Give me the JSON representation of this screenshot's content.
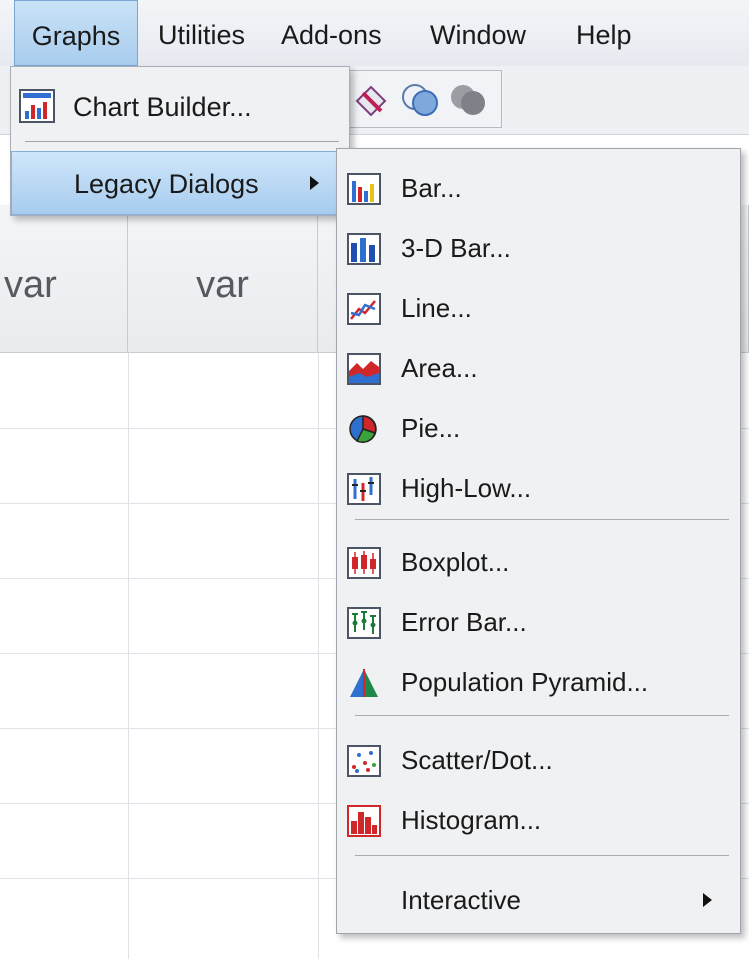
{
  "menubar": {
    "items": [
      {
        "label": "Graphs",
        "active": true
      },
      {
        "label": "Utilities"
      },
      {
        "label": "Add-ons"
      },
      {
        "label": "Window"
      },
      {
        "label": "Help"
      }
    ]
  },
  "grid": {
    "col_headers": [
      "var",
      "var"
    ]
  },
  "graphs_menu": {
    "items": [
      {
        "label": "Chart Builder...",
        "icon": "chart-builder-icon"
      },
      {
        "label": "Legacy Dialogs",
        "icon": "none",
        "has_submenu": true,
        "highlighted": true
      }
    ]
  },
  "legacy_menu": {
    "items": [
      {
        "label": "Bar...",
        "icon": "bar-chart-icon"
      },
      {
        "label": "3-D Bar...",
        "icon": "3d-bar-chart-icon"
      },
      {
        "label": "Line...",
        "icon": "line-chart-icon"
      },
      {
        "label": "Area...",
        "icon": "area-chart-icon"
      },
      {
        "label": "Pie...",
        "icon": "pie-chart-icon"
      },
      {
        "label": "High-Low...",
        "icon": "high-low-chart-icon"
      },
      {
        "label": "Boxplot...",
        "icon": "boxplot-icon"
      },
      {
        "label": "Error Bar...",
        "icon": "error-bar-icon"
      },
      {
        "label": "Population Pyramid...",
        "icon": "population-pyramid-icon"
      },
      {
        "label": "Scatter/Dot...",
        "icon": "scatter-dot-icon"
      },
      {
        "label": "Histogram...",
        "icon": "histogram-icon"
      },
      {
        "label": "Interactive",
        "icon": "none",
        "has_submenu": true
      }
    ]
  },
  "colors": {
    "menu_bg": "#f0f1f3",
    "highlight": "#a7ccef",
    "accent_blue": "#2f6fd0",
    "accent_red": "#d0282a"
  }
}
